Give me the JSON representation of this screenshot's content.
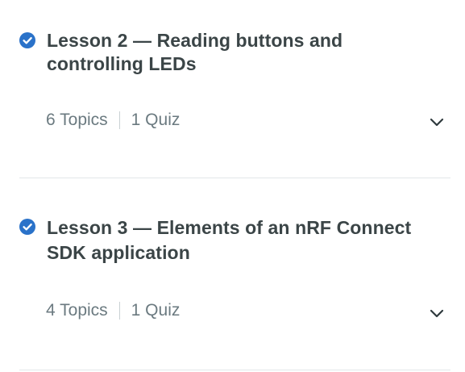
{
  "lessons": [
    {
      "title_line1": "Lesson 2 — Reading buttons and",
      "title_line2": "controlling LEDs",
      "topics": "6 Topics",
      "quiz": "1 Quiz",
      "completed": true
    },
    {
      "title_line1": "Lesson 3 — Elements of an nRF Connect",
      "title_line2": "SDK application",
      "topics": "4 Topics",
      "quiz": "1 Quiz",
      "completed": true
    }
  ],
  "colors": {
    "check_blue": "#2a72c9",
    "title": "#3b4547",
    "meta": "#6b7a80",
    "divider": "#e3e7e9"
  }
}
